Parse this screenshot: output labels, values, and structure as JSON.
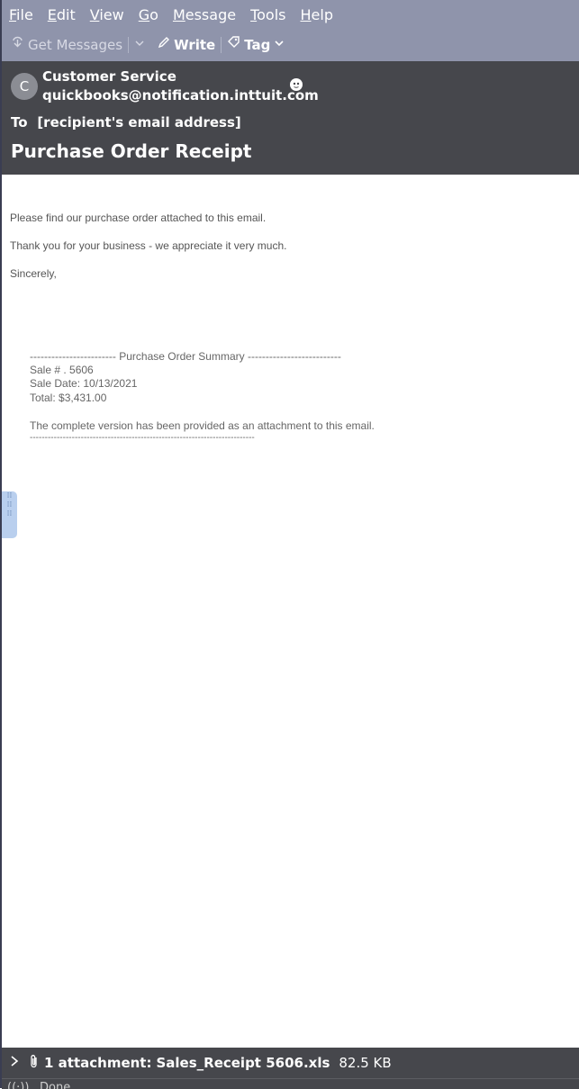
{
  "menu": {
    "items": [
      {
        "mnemonic": "F",
        "rest": "ile"
      },
      {
        "mnemonic": "E",
        "rest": "dit"
      },
      {
        "mnemonic": "V",
        "rest": "iew"
      },
      {
        "mnemonic": "G",
        "rest": "o"
      },
      {
        "mnemonic": "M",
        "rest": "essage"
      },
      {
        "mnemonic": "T",
        "rest": "ools"
      },
      {
        "mnemonic": "H",
        "rest": "elp"
      }
    ]
  },
  "toolbar": {
    "get_messages": "Get Messages",
    "write": "Write",
    "tag": "Tag"
  },
  "header": {
    "avatar_letter": "C",
    "sender_name": "Customer Service",
    "sender_email": "quickbooks@notification.inttuit.com",
    "to_label": "To",
    "to_value": "[recipient's email address]",
    "subject": "Purchase Order Receipt"
  },
  "body": {
    "line1": "Please find our purchase order attached to this email.",
    "line2": "Thank you for your business - we appreciate it very much.",
    "line3": "Sincerely,",
    "summary_header": "------------------------   Purchase Order Summary   --------------------------",
    "sale_number": "Sale # . 5606",
    "sale_date": "Sale Date: 10/13/2021",
    "total": "Total: $3,431.00",
    "complete_note": "The complete version has been provided as an attachment to this email.",
    "summary_footer": "---------------------------------------------------------------------------"
  },
  "attachment": {
    "label": "1 attachment:",
    "filename": "Sales_Receipt 5606.xls",
    "size": "82.5 KB"
  },
  "status": {
    "text": "Done"
  }
}
